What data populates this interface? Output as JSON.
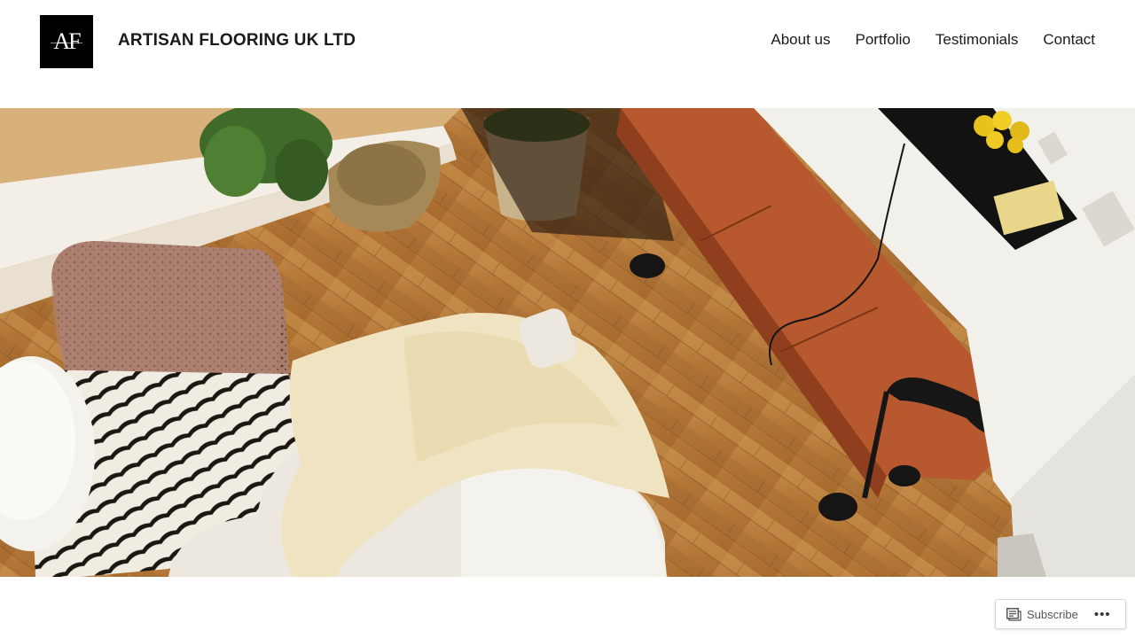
{
  "header": {
    "logo_text": "AF",
    "site_title": "ARTISAN FLOORING UK LTD",
    "nav": [
      {
        "label": "About us"
      },
      {
        "label": "Portfolio"
      },
      {
        "label": "Testimonials"
      },
      {
        "label": "Contact"
      }
    ]
  },
  "hero": {
    "icon": "photo-of-oak-floor-living-room"
  },
  "footer_bar": {
    "subscribe_label": "Subscribe",
    "more_label": "•••",
    "icons": [
      "reader-icon",
      "more-icon"
    ]
  },
  "colors": {
    "text": "#1a1a1a",
    "logo_bg": "#000000",
    "background": "#ffffff"
  }
}
